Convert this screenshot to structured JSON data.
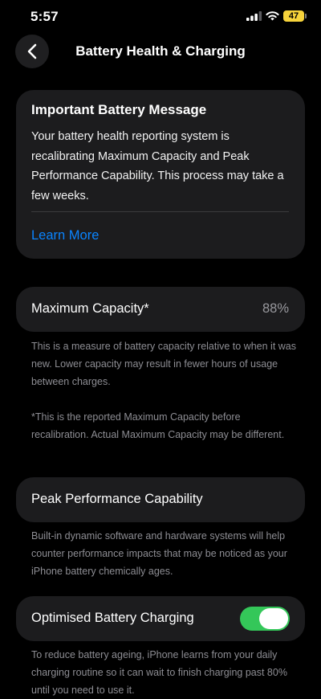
{
  "status_bar": {
    "time": "5:57",
    "battery_level": "47",
    "icons": [
      "signal-icon",
      "wifi-icon",
      "battery-icon"
    ]
  },
  "nav": {
    "back_icon": "chevron-left-icon",
    "title": "Battery Health & Charging"
  },
  "message_card": {
    "title": "Important Battery Message",
    "body": "Your battery health reporting system is recalibrating Maximum Capacity and Peak Performance Capability. This process may take a few weeks.",
    "link": "Learn More"
  },
  "maximum_capacity": {
    "label": "Maximum Capacity*",
    "value": "88%",
    "description": "This is a measure of battery capacity relative to when it was new. Lower capacity may result in fewer hours of usage between charges.",
    "footnote": "*This is the reported Maximum Capacity before recalibration. Actual Maximum Capacity may be different."
  },
  "peak_performance": {
    "label": "Peak Performance Capability",
    "description": "Built-in dynamic software and hardware systems will help counter performance impacts that may be noticed as your iPhone battery chemically ages."
  },
  "optimised_charging": {
    "label": "Optimised Battery Charging",
    "enabled": true,
    "description": "To reduce battery ageing, iPhone learns from your daily charging routine so it can wait to finish charging past 80% until you need to use it."
  },
  "colors": {
    "background": "#000000",
    "card": "#1c1c1e",
    "link": "#0a84ff",
    "toggle_on": "#34c759",
    "secondary_text": "#8d8d93",
    "battery_fill": "#f6d33b"
  }
}
